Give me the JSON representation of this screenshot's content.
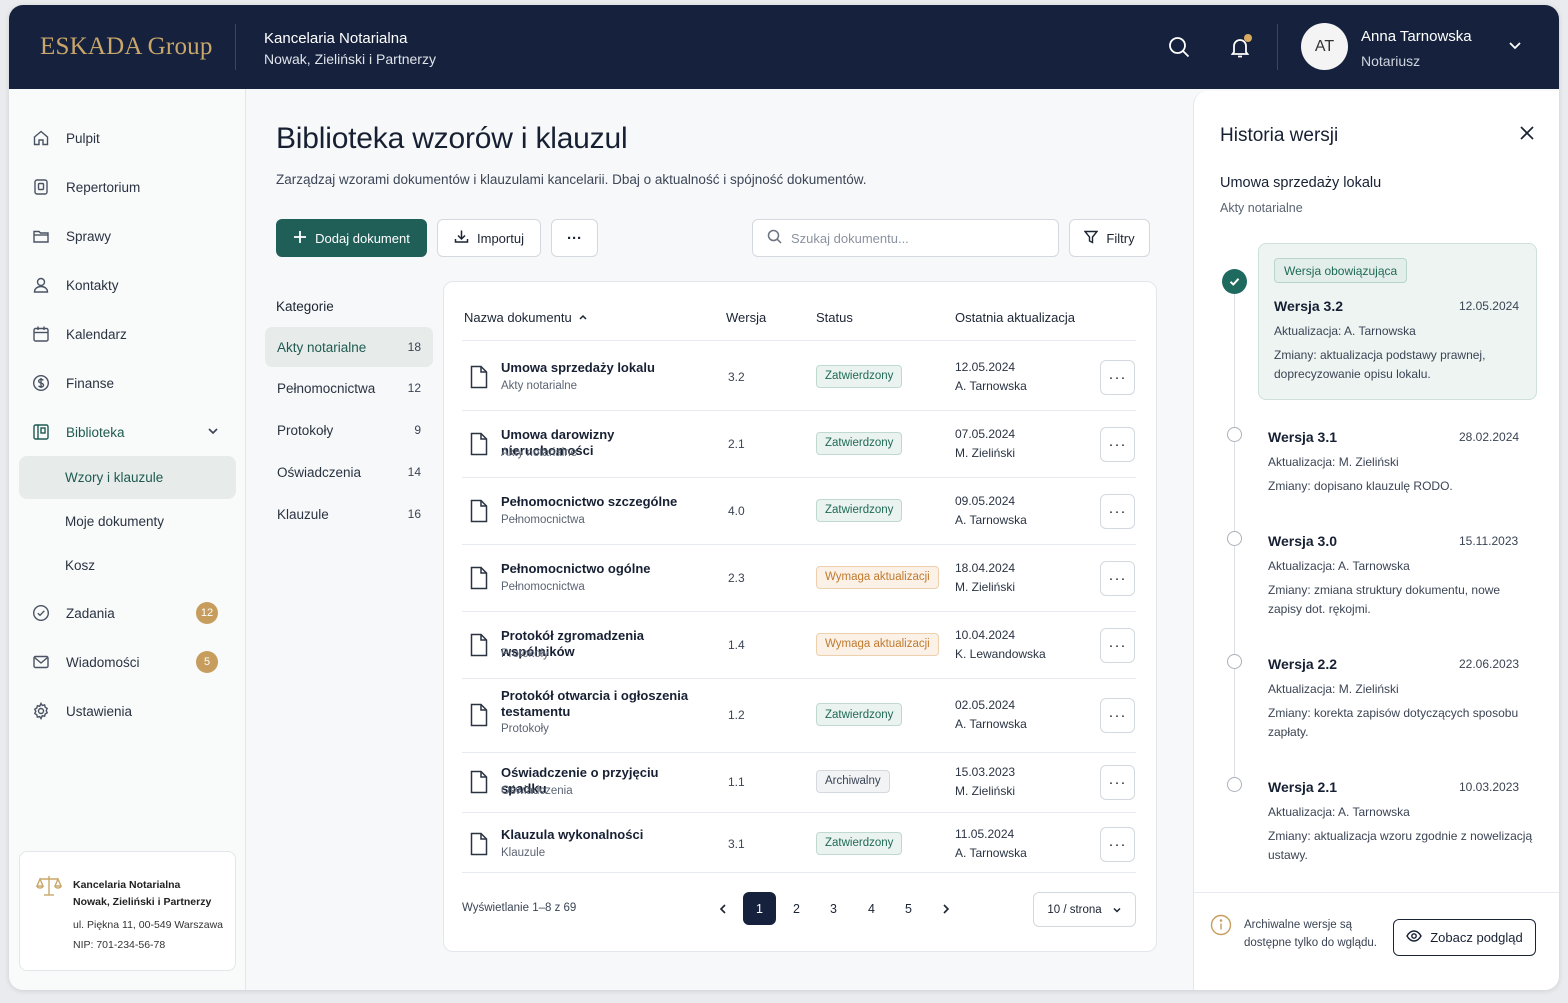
{
  "header": {
    "logo": "ESKADA Group",
    "firm_line1": "Kancelaria Notarialna",
    "firm_line2": "Nowak, Zieliński i Partnerzy",
    "user_initials": "AT",
    "user_name": "Anna Tarnowska",
    "user_role": "Notariusz"
  },
  "sidebar": {
    "items": [
      {
        "label": "Pulpit",
        "icon": "home-icon"
      },
      {
        "label": "Repertorium",
        "icon": "register-icon"
      },
      {
        "label": "Sprawy",
        "icon": "folder-icon"
      },
      {
        "label": "Kontakty",
        "icon": "user-icon"
      },
      {
        "label": "Kalendarz",
        "icon": "calendar-icon"
      },
      {
        "label": "Finanse",
        "icon": "dollar-icon"
      },
      {
        "label": "Biblioteka",
        "icon": "library-icon"
      },
      {
        "label": "Wzory i klauzule"
      },
      {
        "label": "Moje dokumenty"
      },
      {
        "label": "Kosz"
      },
      {
        "label": "Zadania",
        "icon": "check-circle-icon",
        "badge": "12"
      },
      {
        "label": "Wiadomości",
        "icon": "mail-icon",
        "badge": "5"
      },
      {
        "label": "Ustawienia",
        "icon": "gear-icon"
      }
    ],
    "firm_card": {
      "name1": "Kancelaria Notarialna",
      "name2": "Nowak, Zieliński i Partnerzy",
      "address": "ul. Piękna 11, 00-549 Warszawa",
      "nip": "NIP: 701-234-56-78"
    }
  },
  "main": {
    "title": "Biblioteka wzorów i klauzul",
    "subtitle": "Zarządzaj wzorami dokumentów i klauzulami kancelarii. Dbaj o aktualność i spójność dokumentów.",
    "add_button": "Dodaj dokument",
    "import_button": "Importuj",
    "more_button": "···",
    "search_placeholder": "Szukaj dokumentu...",
    "filters_button": "Filtry"
  },
  "categories": {
    "title": "Kategorie",
    "items": [
      {
        "label": "Akty notarialne",
        "count": "18"
      },
      {
        "label": "Pełnomocnictwa",
        "count": "12"
      },
      {
        "label": "Protokoły",
        "count": "9"
      },
      {
        "label": "Oświadczenia",
        "count": "14"
      },
      {
        "label": "Klauzule",
        "count": "16"
      }
    ]
  },
  "table": {
    "headers": {
      "name": "Nazwa dokumentu",
      "version": "Wersja",
      "status": "Status",
      "updated": "Ostatnia aktualizacja"
    },
    "rows": [
      {
        "name": "Umowa sprzedaży lokalu",
        "category": "Akty notarialne",
        "version": "3.2",
        "status": "Zatwierdzony",
        "date": "12.05.2024",
        "author": "A. Tarnowska"
      },
      {
        "name": "Umowa darowizny nieruchomości",
        "category": "Akty notarialne",
        "version": "2.1",
        "status": "Zatwierdzony",
        "date": "07.05.2024",
        "author": "M. Zieliński"
      },
      {
        "name": "Pełnomocnictwo szczególne",
        "category": "Pełnomocnictwa",
        "version": "4.0",
        "status": "Zatwierdzony",
        "date": "09.05.2024",
        "author": "A. Tarnowska"
      },
      {
        "name": "Pełnomocnictwo ogólne",
        "category": "Pełnomocnictwa",
        "version": "2.3",
        "status": "Wymaga aktualizacji",
        "date": "18.04.2024",
        "author": "M. Zieliński"
      },
      {
        "name": "Protokół zgromadzenia wspólników",
        "category": "Protokoły",
        "version": "1.4",
        "status": "Wymaga aktualizacji",
        "date": "10.04.2024",
        "author": "K. Lewandowska"
      },
      {
        "name": "Protokół otwarcia i ogłoszenia testamentu",
        "category": "Protokoły",
        "version": "1.2",
        "status": "Zatwierdzony",
        "date": "02.05.2024",
        "author": "A. Tarnowska"
      },
      {
        "name": "Oświadczenie o przyjęciu spadku",
        "category": "Oświadczenia",
        "version": "1.1",
        "status": "Archiwalny",
        "date": "15.03.2023",
        "author": "M. Zieliński"
      },
      {
        "name": "Klauzula wykonalności",
        "category": "Klauzule",
        "version": "3.1",
        "status": "Zatwierdzony",
        "date": "11.05.2024",
        "author": "A. Tarnowska"
      }
    ],
    "row_menu": "···",
    "pagination_info": "Wyświetlanie 1–8 z 69",
    "pages": [
      "1",
      "2",
      "3",
      "4",
      "5"
    ],
    "per_page": "10 / strona"
  },
  "panel": {
    "title": "Historia wersji",
    "doc_name": "Umowa sprzedaży lokalu",
    "doc_category": "Akty notarialne",
    "current_badge": "Wersja obowiązująca",
    "versions": [
      {
        "name": "Wersja 3.2",
        "date": "12.05.2024",
        "updated": "Aktualizacja: A. Tarnowska",
        "changes": "Zmiany: aktualizacja podstawy prawnej, doprecyzowanie opisu lokalu."
      },
      {
        "name": "Wersja 3.1",
        "date": "28.02.2024",
        "updated": "Aktualizacja: M. Zieliński",
        "changes": "Zmiany: dopisano klauzulę RODO."
      },
      {
        "name": "Wersja 3.0",
        "date": "15.11.2023",
        "updated": "Aktualizacja: A. Tarnowska",
        "changes": "Zmiany: zmiana struktury dokumentu, nowe zapisy dot. rękojmi."
      },
      {
        "name": "Wersja 2.2",
        "date": "22.06.2023",
        "updated": "Aktualizacja: M. Zieliński",
        "changes": "Zmiany: korekta zapisów dotyczących sposobu zapłaty."
      },
      {
        "name": "Wersja 2.1",
        "date": "10.03.2023",
        "updated": "Aktualizacja: A. Tarnowska",
        "changes": "Zmiany: aktualizacja wzoru zgodnie z nowelizacją ustawy."
      }
    ],
    "footer_note": "Archiwalne wersje są dostępne tylko do wglądu.",
    "preview_button": "Zobacz podgląd"
  },
  "colors": {
    "navy": "#16223d",
    "accent": "#1f5f57",
    "gold": "#c79d5e",
    "warn": "#c07a2f"
  }
}
